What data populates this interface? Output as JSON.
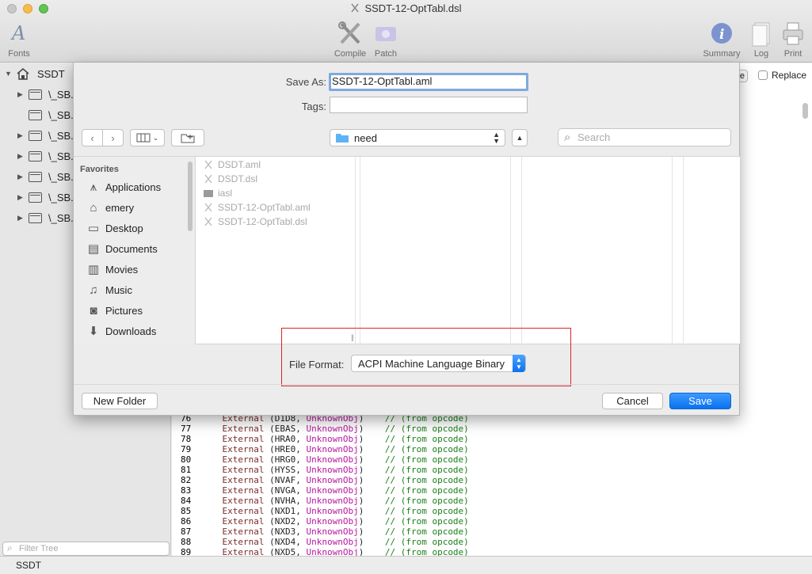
{
  "window": {
    "title": "SSDT-12-OptTabl.dsl"
  },
  "toolbar": {
    "fonts": "Fonts",
    "compile": "Compile",
    "patch": "Patch",
    "summary": "Summary",
    "log": "Log",
    "print": "Print"
  },
  "sidebar": {
    "root": "SSDT",
    "items": [
      "\\_SB.",
      "\\_SB.",
      "\\_SB.",
      "\\_SB.",
      "\\_SB.",
      "\\_SB.",
      "\\_SB."
    ],
    "filter_placeholder": "Filter Tree"
  },
  "find": {
    "button_fragment": "e",
    "replace_label": "Replace"
  },
  "statusbar": {
    "text": "SSDT"
  },
  "save_sheet": {
    "save_as_label": "Save As:",
    "save_as_value": "SSDT-12-OptTabl.aml",
    "tags_label": "Tags:",
    "tags_value": "",
    "location": "need",
    "search_placeholder": "Search",
    "favorites_header": "Favorites",
    "favorites": [
      "Applications",
      "emery",
      "Desktop",
      "Documents",
      "Movies",
      "Music",
      "Pictures",
      "Downloads"
    ],
    "files": [
      "DSDT.aml",
      "DSDT.dsl",
      "iasl",
      "SSDT-12-OptTabl.aml",
      "SSDT-12-OptTabl.dsl"
    ],
    "file_format_label": "File Format:",
    "file_format_value": "ACPI Machine Language Binary",
    "new_folder": "New Folder",
    "cancel": "Cancel",
    "save": "Save"
  },
  "code": {
    "lines": [
      {
        "n": "76",
        "name": "D1D8"
      },
      {
        "n": "77",
        "name": "EBAS"
      },
      {
        "n": "78",
        "name": "HRA0"
      },
      {
        "n": "79",
        "name": "HRE0"
      },
      {
        "n": "80",
        "name": "HRG0"
      },
      {
        "n": "81",
        "name": "HYSS"
      },
      {
        "n": "82",
        "name": "NVAF"
      },
      {
        "n": "83",
        "name": "NVGA"
      },
      {
        "n": "84",
        "name": "NVHA"
      },
      {
        "n": "85",
        "name": "NXD1"
      },
      {
        "n": "86",
        "name": "NXD2"
      },
      {
        "n": "87",
        "name": "NXD3"
      },
      {
        "n": "88",
        "name": "NXD4"
      },
      {
        "n": "89",
        "name": "NXD5"
      }
    ],
    "keyword": "External",
    "type": "UnknownObj",
    "comment": "// (from opcode)"
  },
  "colors": {
    "accent": "#0a72ef",
    "highlight_box": "#d9242a",
    "comment": "#1a7f1a",
    "type": "#b5179e"
  }
}
